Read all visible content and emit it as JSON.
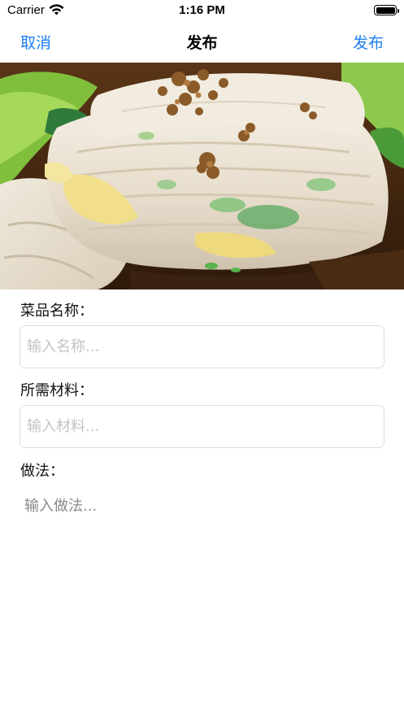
{
  "status_bar": {
    "carrier": "Carrier",
    "time": "1:16 PM"
  },
  "nav": {
    "cancel_label": "取消",
    "title": "发布",
    "publish_label": "发布"
  },
  "form": {
    "name_label": "菜品名称：",
    "name_placeholder": "输入名称...",
    "ingredients_label": "所需材料：",
    "ingredients_placeholder": "输入材料...",
    "method_label": "做法：",
    "method_placeholder": "输入做法..."
  },
  "colors": {
    "accent": "#1b7ef2",
    "field_border": "#dcdcdc"
  },
  "icons": [
    "wifi-icon",
    "battery-icon"
  ]
}
